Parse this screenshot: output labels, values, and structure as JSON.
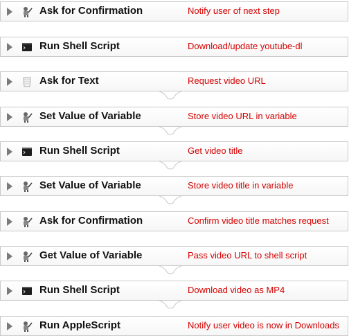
{
  "actions": [
    {
      "title": "Ask for Confirmation",
      "note": "Notify user of next step",
      "icon": "robot-icon"
    },
    {
      "title": "Run Shell Script",
      "note": "Download/update youtube-dl",
      "icon": "terminal-icon"
    },
    {
      "title": "Ask for Text",
      "note": "Request video URL",
      "icon": "text-cup-icon"
    },
    {
      "title": "Set Value of Variable",
      "note": "Store video URL in variable",
      "icon": "robot-icon"
    },
    {
      "title": "Run Shell Script",
      "note": "Get video title",
      "icon": "terminal-icon"
    },
    {
      "title": "Set Value of Variable",
      "note": "Store video title in variable",
      "icon": "robot-icon"
    },
    {
      "title": "Ask for Confirmation",
      "note": "Confirm video title matches request",
      "icon": "robot-icon"
    },
    {
      "title": "Get Value of Variable",
      "note": "Pass video URL to shell script",
      "icon": "robot-icon"
    },
    {
      "title": "Run Shell Script",
      "note": "Download video as MP4",
      "icon": "terminal-icon"
    },
    {
      "title": "Run AppleScript",
      "note": "Notify user video is now in Downloads",
      "icon": "robot-icon"
    }
  ]
}
